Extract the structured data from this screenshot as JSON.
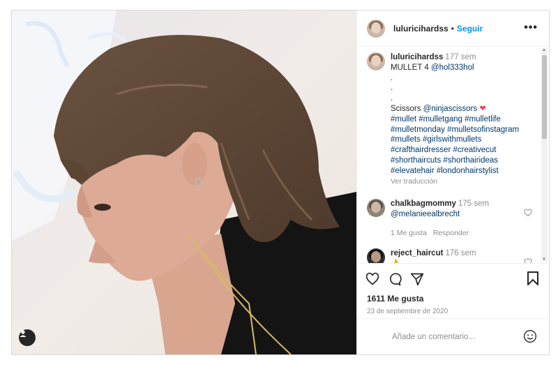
{
  "post": {
    "username": "luluricihardss",
    "follow_label": "Seguir",
    "more_label": "•••",
    "caption": {
      "username": "luluricihardss",
      "time": "177 sem",
      "lines": [
        "MULLET 4",
        ".",
        ".",
        ".",
        "Scissors",
        "#mullet #mulletgang #mulletlife",
        "#mulletmonday #mulletsofinstagram",
        "#mullets #girlswithmullets",
        "#crafthairdresser #creativecut",
        "#shorthaircuts #shorthairideas",
        "#elevatehair #londonhairstylist"
      ],
      "mention1": "@hol333hol",
      "mention2": "@ninjascissors",
      "translate": "Ver traducción"
    },
    "comments": [
      {
        "username": "chalkbagmommy",
        "time": "175 sem",
        "text": "@melanieealbrecht",
        "likes_label": "1 Me gusta",
        "reply_label": "Responder"
      },
      {
        "username": "reject_haircut",
        "time": "176 sem",
        "text": "👌"
      }
    ],
    "likes": "1611 Me gusta",
    "date": "23 de septiembre de 2020",
    "add_comment_placeholder": "Añade un comentario...",
    "colors": {
      "accent": "#0095f6",
      "heart": "#ed4956",
      "link": "#00376b"
    }
  }
}
